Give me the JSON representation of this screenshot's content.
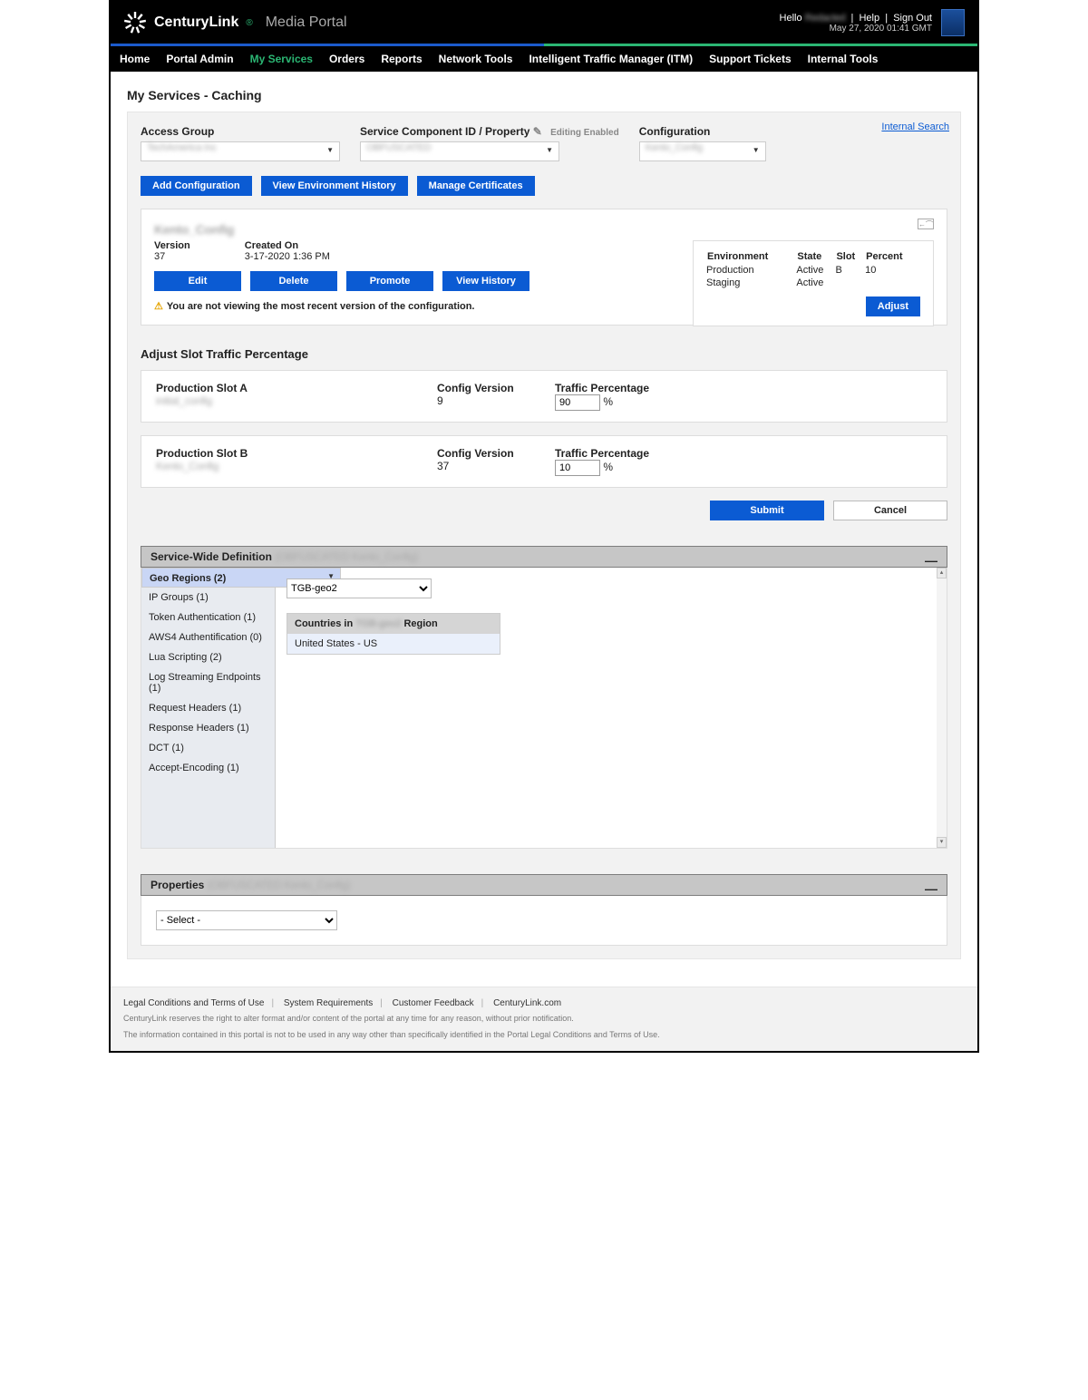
{
  "header": {
    "brand_name": "CenturyLink",
    "brand_sub": "Media Portal",
    "hello": "Hello",
    "username": "Redacted",
    "help": "Help",
    "signout": "Sign Out",
    "timestamp": "May 27, 2020 01:41 GMT"
  },
  "nav": {
    "items": [
      "Home",
      "Portal Admin",
      "My Services",
      "Orders",
      "Reports",
      "Network Tools",
      "Intelligent Traffic Manager (ITM)",
      "Support Tickets",
      "Internal Tools"
    ],
    "active_index": 2
  },
  "page_title": "My Services - Caching",
  "internal_search": "Internal Search",
  "filters": {
    "access_group": {
      "label": "Access Group",
      "value": "TechAmerica Inc"
    },
    "scid": {
      "label": "Service Component ID / Property",
      "editing": "Editing Enabled",
      "value": "OBFUSCATED"
    },
    "configuration": {
      "label": "Configuration",
      "value": "Kento_Config"
    }
  },
  "actions": {
    "add_config": "Add Configuration",
    "view_env_history": "View Environment History",
    "manage_certs": "Manage Certificates"
  },
  "config_card": {
    "title": "Kento_Config",
    "version_label": "Version",
    "version": "37",
    "created_label": "Created On",
    "created": "3-17-2020 1:36 PM",
    "edit": "Edit",
    "delete": "Delete",
    "promote": "Promote",
    "view_history": "View History",
    "warning": "You are not viewing the most recent version of the configuration."
  },
  "env_box": {
    "h_env": "Environment",
    "h_state": "State",
    "h_slot": "Slot",
    "h_percent": "Percent",
    "rows": [
      {
        "env": "Production",
        "state": "Active",
        "slot": "B",
        "percent": "10"
      },
      {
        "env": "Staging",
        "state": "Active",
        "slot": "",
        "percent": ""
      }
    ],
    "adjust": "Adjust"
  },
  "slot_section_title": "Adjust Slot Traffic Percentage",
  "slots": {
    "col_config": "Config Version",
    "col_pct": "Traffic Percentage",
    "a": {
      "title": "Production Slot A",
      "config_name": "initial_config",
      "config_version": "9",
      "pct": "90"
    },
    "b": {
      "title": "Production Slot B",
      "config_name": "Kento_Config",
      "config_version": "37",
      "pct": "10"
    },
    "submit": "Submit",
    "cancel": "Cancel"
  },
  "swd": {
    "title": "Service-Wide Definition",
    "title_suffix": "(OBFUSCATED  Kento_Config)",
    "tabs": [
      "Geo Regions (2)",
      "IP Groups (1)",
      "Token Authentication (1)",
      "AWS4 Authentification (0)",
      "Lua Scripting (2)",
      "Log Streaming Endpoints (1)",
      "Request Headers (1)",
      "Response Headers (1)",
      "DCT (1)",
      "Accept-Encoding (1)"
    ],
    "active_tab": 0,
    "region_select": "TGB-geo2",
    "countries_header_prefix": "Countries in ",
    "countries_header_suffix": " Region",
    "countries_header_value": "TGB-geo2",
    "country_row": "United States - US"
  },
  "properties": {
    "title": "Properties",
    "title_suffix": "(OBFUSCATED  Kento_Config)",
    "select_placeholder": "- Select -"
  },
  "footer": {
    "links": [
      "Legal Conditions and Terms of Use",
      "System Requirements",
      "Customer Feedback",
      "CenturyLink.com"
    ],
    "fine1": "CenturyLink reserves the right to alter format and/or content of the portal at any time for any reason, without prior notification.",
    "fine2": "The information contained in this portal is not to be used in any way other than specifically identified in the Portal Legal Conditions and Terms of Use."
  }
}
